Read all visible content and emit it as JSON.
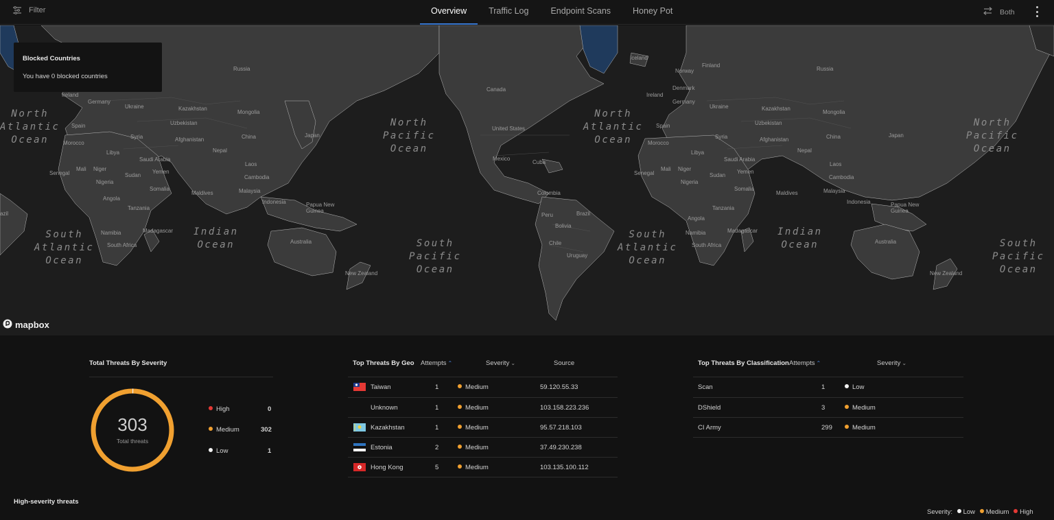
{
  "topbar": {
    "filter_label": "Filter",
    "tabs": [
      {
        "label": "Overview",
        "active": true
      },
      {
        "label": "Traffic Log",
        "active": false
      },
      {
        "label": "Endpoint Scans",
        "active": false
      },
      {
        "label": "Honey Pot",
        "active": false
      }
    ],
    "direction_label": "Both",
    "icons": [
      "filter-icon",
      "swap-arrows-icon",
      "more-vert-icon"
    ]
  },
  "map": {
    "blocked": {
      "title": "Blocked Countries",
      "subtitle": "You have 0 blocked countries"
    },
    "attribution": "mapbox",
    "oceans": {
      "north_atlantic": "North\nAtlantic\nOcean",
      "north_pacific": "North\nPacific\nOcean",
      "south_atlantic": "South\nAtlantic\nOcean",
      "indian": "Indian\nOcean",
      "south_pacific": "South\nPacific\nOcean"
    },
    "countries": {
      "russia": "Russia",
      "canada": "Canada",
      "united_states": "United States",
      "mexico": "Mexico",
      "cuba": "Cuba",
      "colombia": "Colombia",
      "peru": "Peru",
      "brazil": "Brazil",
      "bolivia": "Bolivia",
      "chile": "Chile",
      "uruguay": "Uruguay",
      "ireland": "Ireland",
      "iceland": "Iceland",
      "norway": "Norway",
      "finland": "Finland",
      "denmark": "Denmark",
      "germany": "Germany",
      "ukraine": "Ukraine",
      "kazakhstan": "Kazakhstan",
      "mongolia": "Mongolia",
      "china": "China",
      "japan": "Japan",
      "uzbekistan": "Uzbekistan",
      "afghanistan": "Afghanistan",
      "nepal": "Nepal",
      "spain": "Spain",
      "syria": "Syria",
      "morocco": "Morocco",
      "libya": "Libya",
      "saudi_arabia": "Saudi Arabia",
      "yemen": "Yemen",
      "mali": "Mali",
      "niger": "Niger",
      "senegal": "Senegal",
      "nigeria": "Nigeria",
      "sudan": "Sudan",
      "somalia": "Somalia",
      "tanzania": "Tanzania",
      "angola": "Angola",
      "namibia": "Namibia",
      "madagascar": "Madagascar",
      "south_africa": "South Africa",
      "laos": "Laos",
      "cambodia": "Cambodia",
      "malaysia": "Malaysia",
      "indonesia": "Indonesia",
      "papua_new_guinea": "Papua New\nGuinea",
      "maldives": "Maldives",
      "australia": "Australia",
      "new_zealand": "New Zealand",
      "brazil_edge": "azil"
    }
  },
  "severity_panel": {
    "title": "Total Threats By Severity",
    "total": "303",
    "total_label": "Total threats",
    "rows": [
      {
        "label": "High",
        "value": "0",
        "color": "#e53935"
      },
      {
        "label": "Medium",
        "value": "302",
        "color": "#f0a030"
      },
      {
        "label": "Low",
        "value": "1",
        "color": "#f2f2f2"
      }
    ],
    "ring_color": "#f0a030"
  },
  "geo_panel": {
    "title": "Top Threats By Geo",
    "headers": {
      "attempts": "Attempts",
      "severity": "Severity",
      "source": "Source"
    },
    "rows": [
      {
        "country": "Taiwan",
        "attempts": "1",
        "severity": "Medium",
        "source": "59.120.55.33",
        "flag": "tw"
      },
      {
        "country": "Unknown",
        "attempts": "1",
        "severity": "Medium",
        "source": "103.158.223.236",
        "flag": ""
      },
      {
        "country": "Kazakhstan",
        "attempts": "1",
        "severity": "Medium",
        "source": "95.57.218.103",
        "flag": "kz"
      },
      {
        "country": "Estonia",
        "attempts": "2",
        "severity": "Medium",
        "source": "37.49.230.238",
        "flag": "ee"
      },
      {
        "country": "Hong Kong",
        "attempts": "5",
        "severity": "Medium",
        "source": "103.135.100.112",
        "flag": "hk"
      }
    ]
  },
  "class_panel": {
    "title": "Top Threats By Classification",
    "headers": {
      "attempts": "Attempts",
      "severity": "Severity"
    },
    "rows": [
      {
        "name": "Scan",
        "attempts": "1",
        "severity": "Low",
        "color": "#f2f2f2"
      },
      {
        "name": "DShield",
        "attempts": "3",
        "severity": "Medium",
        "color": "#f0a030"
      },
      {
        "name": "CI Army",
        "attempts": "299",
        "severity": "Medium",
        "color": "#f0a030"
      }
    ]
  },
  "footer": {
    "high_severity_title": "High-severity threats",
    "legend_label": "Severity:",
    "legend": [
      {
        "label": "Low",
        "color": "#f2f2f2"
      },
      {
        "label": "Medium",
        "color": "#f0a030"
      },
      {
        "label": "High",
        "color": "#e53935"
      }
    ]
  }
}
